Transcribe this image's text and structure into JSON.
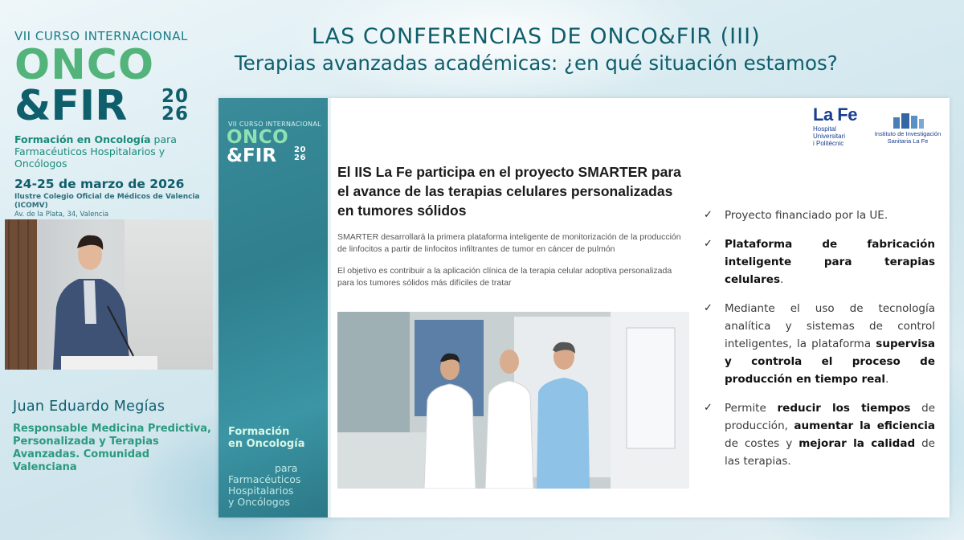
{
  "header": {
    "title": "LAS CONFERENCIAS DE ONCO&FIR (III)",
    "subtitle": "Terapias avanzadas académicas: ¿en qué situación estamos?"
  },
  "branding": {
    "course": "VII CURSO INTERNACIONAL",
    "onco": "ONCO",
    "fir": "&FIR",
    "year_top": "20",
    "year_bottom": "26",
    "tagline_bold": "Formación en Oncología",
    "tagline_rest": " para",
    "tagline2": "Farmacéuticos Hospitalarios y Oncólogos",
    "dates": "24-25 de marzo de 2026",
    "venue": "Ilustre Colegio Oficial de Médicos de Valencia (ICOMV)",
    "address": "Av. de la Plata, 34, Valencia"
  },
  "speaker": {
    "name": "Juan Eduardo Megías",
    "role": "Responsable Medicina Predictiva, Personalizada y Terapias Avanzadas. Comunidad Valenciana"
  },
  "slide": {
    "side": {
      "course": "VII CURSO INTERNACIONAL",
      "onco": "ONCO",
      "fir": "&FIR",
      "year_top": "20",
      "year_bottom": "26",
      "formacion": "Formación",
      "en_oncologia": "en Oncología",
      "para": "para",
      "line1": "Farmacéuticos",
      "line2": "Hospitalarios",
      "line3": "y Oncólogos"
    },
    "logos": {
      "lafe": "La Fe",
      "hospital_lines": [
        "Hospital",
        "Universitari",
        "i Politècnic"
      ],
      "iis_lines": [
        "Instituto de Investigación",
        "Sanitaria La Fe"
      ]
    },
    "article": {
      "headline": "El IIS La Fe participa en el proyecto SMARTER para el avance de las terapias celulares personalizadas en tumores sólidos",
      "p1": "SMARTER desarrollará la primera plataforma inteligente de monitorización de la producción de linfocitos a partir de linfocitos infiltrantes de tumor en cáncer de pulmón",
      "p2": "El objetivo es contribuir a la aplicación clínica de la terapia celular adoptiva personalizada para los tumores sólidos más difíciles de tratar"
    },
    "bullets": [
      {
        "parts": [
          {
            "t": "Proyecto financiado por la UE.",
            "b": false
          }
        ]
      },
      {
        "parts": [
          {
            "t": "Plataforma de fabricación inteligente para terapias celulares",
            "b": true
          },
          {
            "t": ".",
            "b": false
          }
        ]
      },
      {
        "parts": [
          {
            "t": "Mediante el uso de tecnología analítica y sistemas de control inteligentes, la plataforma ",
            "b": false
          },
          {
            "t": "supervisa y controla el proceso de producción en tiempo real",
            "b": true
          },
          {
            "t": ".",
            "b": false
          }
        ]
      },
      {
        "parts": [
          {
            "t": "Permite ",
            "b": false
          },
          {
            "t": "reducir los tiempos",
            "b": true
          },
          {
            "t": " de producción, ",
            "b": false
          },
          {
            "t": "aumentar la eficiencia",
            "b": true
          },
          {
            "t": " de costes y ",
            "b": false
          },
          {
            "t": "mejorar la calidad",
            "b": true
          },
          {
            "t": " de las terapias.",
            "b": false
          }
        ]
      }
    ],
    "check_icon": "✓"
  },
  "colors": {
    "teal_dark": "#0f5e6b",
    "green": "#52b47a",
    "side_panel": "#3a8c9a"
  }
}
